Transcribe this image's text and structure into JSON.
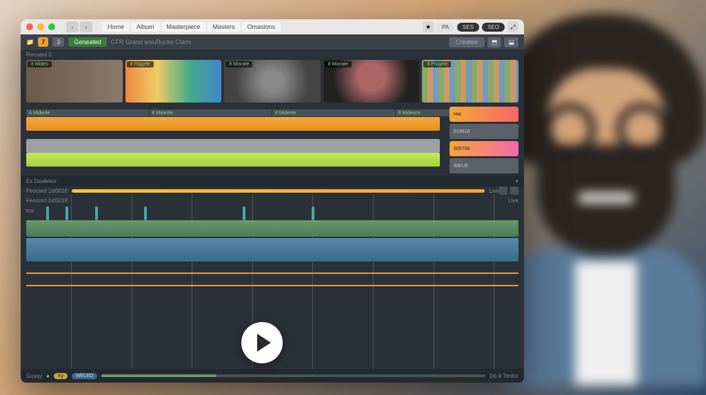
{
  "titlebar": {
    "menu": [
      "Home",
      "Album",
      "Masterpiece",
      "Masters",
      "Omasions"
    ],
    "right_pills": [
      "PA",
      "SES",
      "SEO"
    ],
    "star": "★"
  },
  "subheader": {
    "icon_num": "7",
    "badge1": "3",
    "tab_green": "Geneated",
    "info": "CFR Grand aniuRucke Clans",
    "create": "Createe",
    "icons": [
      "⬒",
      "⬓"
    ]
  },
  "section1_label": "Recoard 0",
  "thumbs": [
    "8 Mideo",
    "8 Riggele",
    "8 Miorate",
    "8 Miorate",
    "8 Progele"
  ],
  "clip_headers": [
    "8 Mideole",
    "8 Mideole",
    "8 Mideole",
    "8 Mideoce"
  ],
  "side_panel": [
    "Hal",
    "019618",
    "605708",
    "WEUE"
  ],
  "mid_label": "Ex Diodebor",
  "progress": {
    "label": "Feocord 1st0018",
    "right": "Live"
  },
  "timeline": {
    "tracks": [
      "Teld",
      "",
      ""
    ],
    "grid_positions": [
      10,
      22,
      34,
      46,
      58,
      70,
      82,
      94
    ],
    "markers": [
      4,
      8,
      14,
      24,
      44,
      58
    ]
  },
  "footer": {
    "label": "Gusay",
    "badges": [
      "Ky",
      "WELED"
    ],
    "right": "Do 8 Terdor"
  },
  "play_button": "Play"
}
